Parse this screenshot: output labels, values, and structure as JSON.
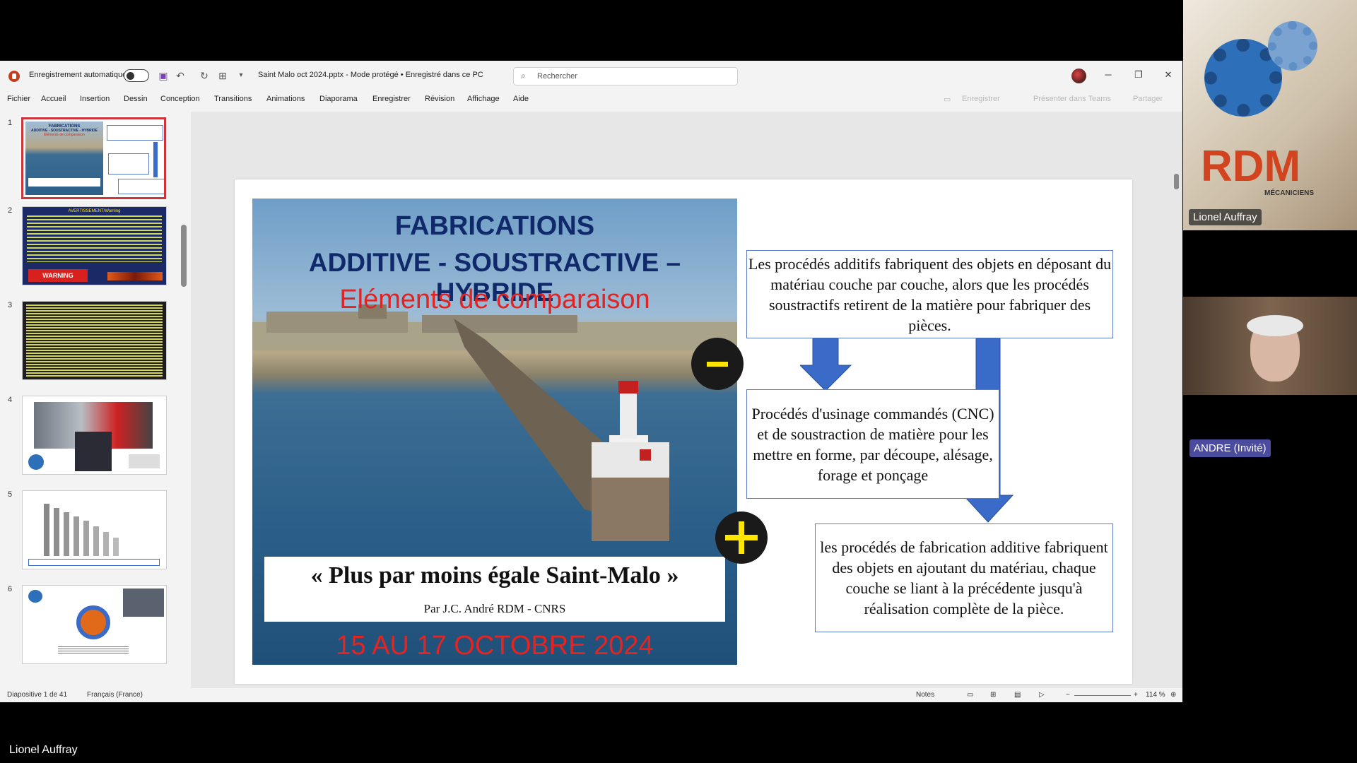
{
  "titlebar": {
    "autosave_label": "Enregistrement automatique",
    "document_title": "Saint Malo oct 2024.pptx  -  Mode protégé  •  Enregistré dans ce PC",
    "search_placeholder": "Rechercher"
  },
  "menu": [
    "Fichier",
    "Accueil",
    "Insertion",
    "Dessin",
    "Conception",
    "Transitions",
    "Animations",
    "Diaporama",
    "Enregistrer",
    "Révision",
    "Affichage",
    "Aide"
  ],
  "menu_right": {
    "record": "Enregistrer",
    "teams": "Présenter dans Teams",
    "share": "Partager"
  },
  "thumbnails": [
    {
      "num": "1",
      "selected": true,
      "title": "FABRICATIONS",
      "sub": "ADDITIVE - SOUSTRACTIVE - HYBRIDE",
      "sub2": "Eléments de comparaison"
    },
    {
      "num": "2",
      "selected": false,
      "title": "AVERTISSEMENT/Warning",
      "badge": "WARNING"
    },
    {
      "num": "3",
      "selected": false
    },
    {
      "num": "4",
      "selected": false
    },
    {
      "num": "5",
      "selected": false
    },
    {
      "num": "6",
      "selected": false
    }
  ],
  "slide": {
    "title_line1": "FABRICATIONS",
    "title_line2": "ADDITIVE - SOUSTRACTIVE – HYBRIDE",
    "subtitle": "Eléments de comparaison",
    "quote": "« Plus par moins égale Saint-Malo »",
    "author": "Par J.C. André RDM - CNRS",
    "dates": "15 AU 17 OCTOBRE 2024",
    "box_top": "Les procédés additifs fabriquent des objets en déposant du matériau couche par couche, alors que les procédés soustractifs retirent de la matière pour fabriquer des pièces.",
    "box_middle": "Procédés d'usinage commandés (CNC) et de soustraction de matière pour les mettre en forme, par découpe, alésage, forage et ponçage",
    "box_bottom": "les procédés de fabrication additive fabriquent des objets en ajoutant du matériau, chaque couche se liant à la précédente jusqu'à réalisation complète de la pièce."
  },
  "status": {
    "slide_count": "Diapositive 1 de 41",
    "language": "Français (France)",
    "notes": "Notes",
    "zoom": "114 %"
  },
  "participants": {
    "cam1_name": "Lionel Auffray",
    "cam2_label": "ANDRE (Invité)",
    "cam1_logo_text": "RDM",
    "cam1_logo_sub": "MÉCANICIENS",
    "presenter": "Lionel Auffray"
  },
  "colors": {
    "accent_red": "#d13438",
    "slide_title_blue": "#10296a",
    "slide_red": "#e02323",
    "arrow_blue": "#3a6bc9",
    "guest_badge": "#4b4ba0"
  }
}
